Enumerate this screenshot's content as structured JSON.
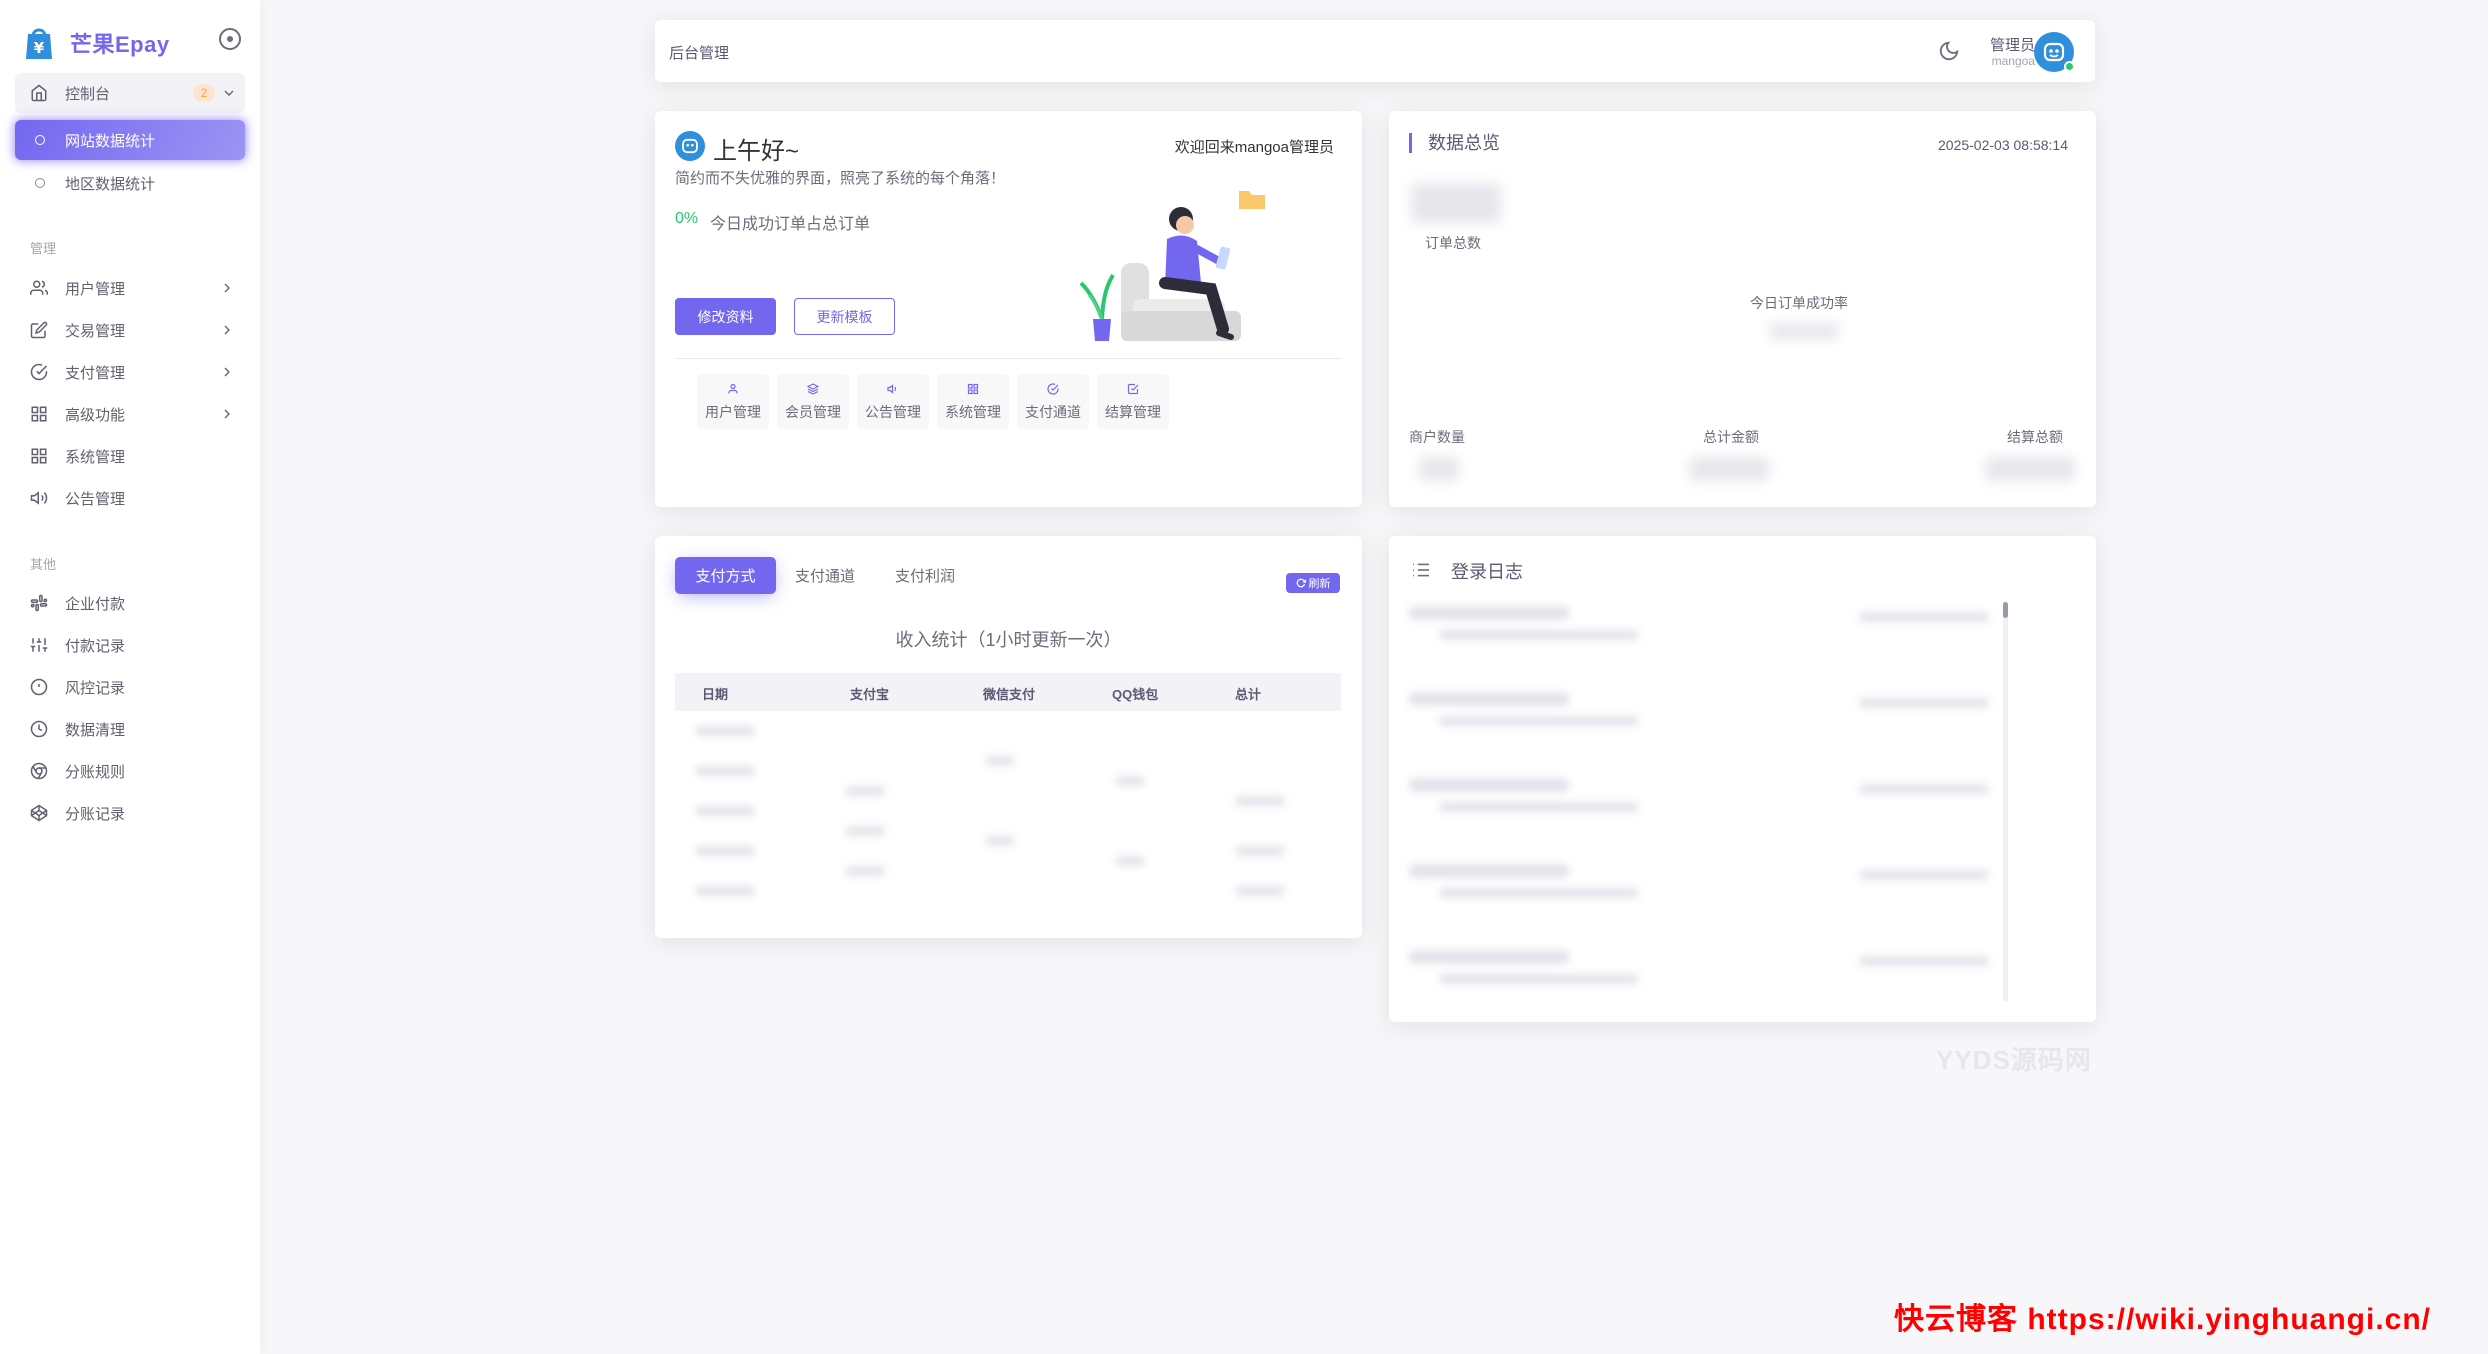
{
  "sidebar": {
    "brand": "芒果Epay",
    "dashboard": {
      "label": "控制台",
      "badge": "2"
    },
    "sub_items": [
      {
        "label": "网站数据统计"
      },
      {
        "label": "地区数据统计"
      }
    ],
    "section_manage": "管理",
    "manage_items": [
      {
        "label": "用户管理"
      },
      {
        "label": "交易管理"
      },
      {
        "label": "支付管理"
      },
      {
        "label": "高级功能"
      },
      {
        "label": "系统管理"
      },
      {
        "label": "公告管理"
      }
    ],
    "section_other": "其他",
    "other_items": [
      {
        "label": "企业付款"
      },
      {
        "label": "付款记录"
      },
      {
        "label": "风控记录"
      },
      {
        "label": "数据清理"
      },
      {
        "label": "分账规则"
      },
      {
        "label": "分账记录"
      }
    ]
  },
  "navbar": {
    "title": "后台管理",
    "user_name": "管理员",
    "user_role": "mangoa"
  },
  "welcome": {
    "greeting": "上午好~",
    "welcome_back": "欢迎回来mangoa管理员",
    "motto": "简约而不失优雅的界面，照亮了系统的每个角落！",
    "success_pct": "0%",
    "success_desc": "今日成功订单占总订单",
    "btn_edit": "修改资料",
    "btn_template": "更新模板",
    "quick_links": [
      {
        "label": "用户管理"
      },
      {
        "label": "会员管理"
      },
      {
        "label": "公告管理"
      },
      {
        "label": "系统管理"
      },
      {
        "label": "支付通道"
      },
      {
        "label": "结算管理"
      }
    ]
  },
  "overview": {
    "title": "数据总览",
    "date": "2025-02-03 08:58:14",
    "order_total": "订单总数",
    "today_rate": "今日订单成功率",
    "merchant_count": "商户数量",
    "total_amount": "总计金额",
    "settle_total": "结算总额"
  },
  "stats": {
    "tabs": [
      {
        "label": "支付方式"
      },
      {
        "label": "支付通道"
      },
      {
        "label": "支付利润"
      }
    ],
    "refresh": "刷新",
    "caption": "收入统计（1小时更新一次）",
    "columns": [
      "日期",
      "支付宝",
      "微信支付",
      "QQ钱包",
      "总计"
    ]
  },
  "login_log": {
    "title": "登录日志"
  },
  "watermarks": {
    "yyds": "YYDS源码网",
    "blog": "快云博客 https://wiki.yinghuangi.cn/"
  },
  "colors": {
    "primary": "#7367f0",
    "success": "#28c76f",
    "warning": "#ff9f43"
  }
}
